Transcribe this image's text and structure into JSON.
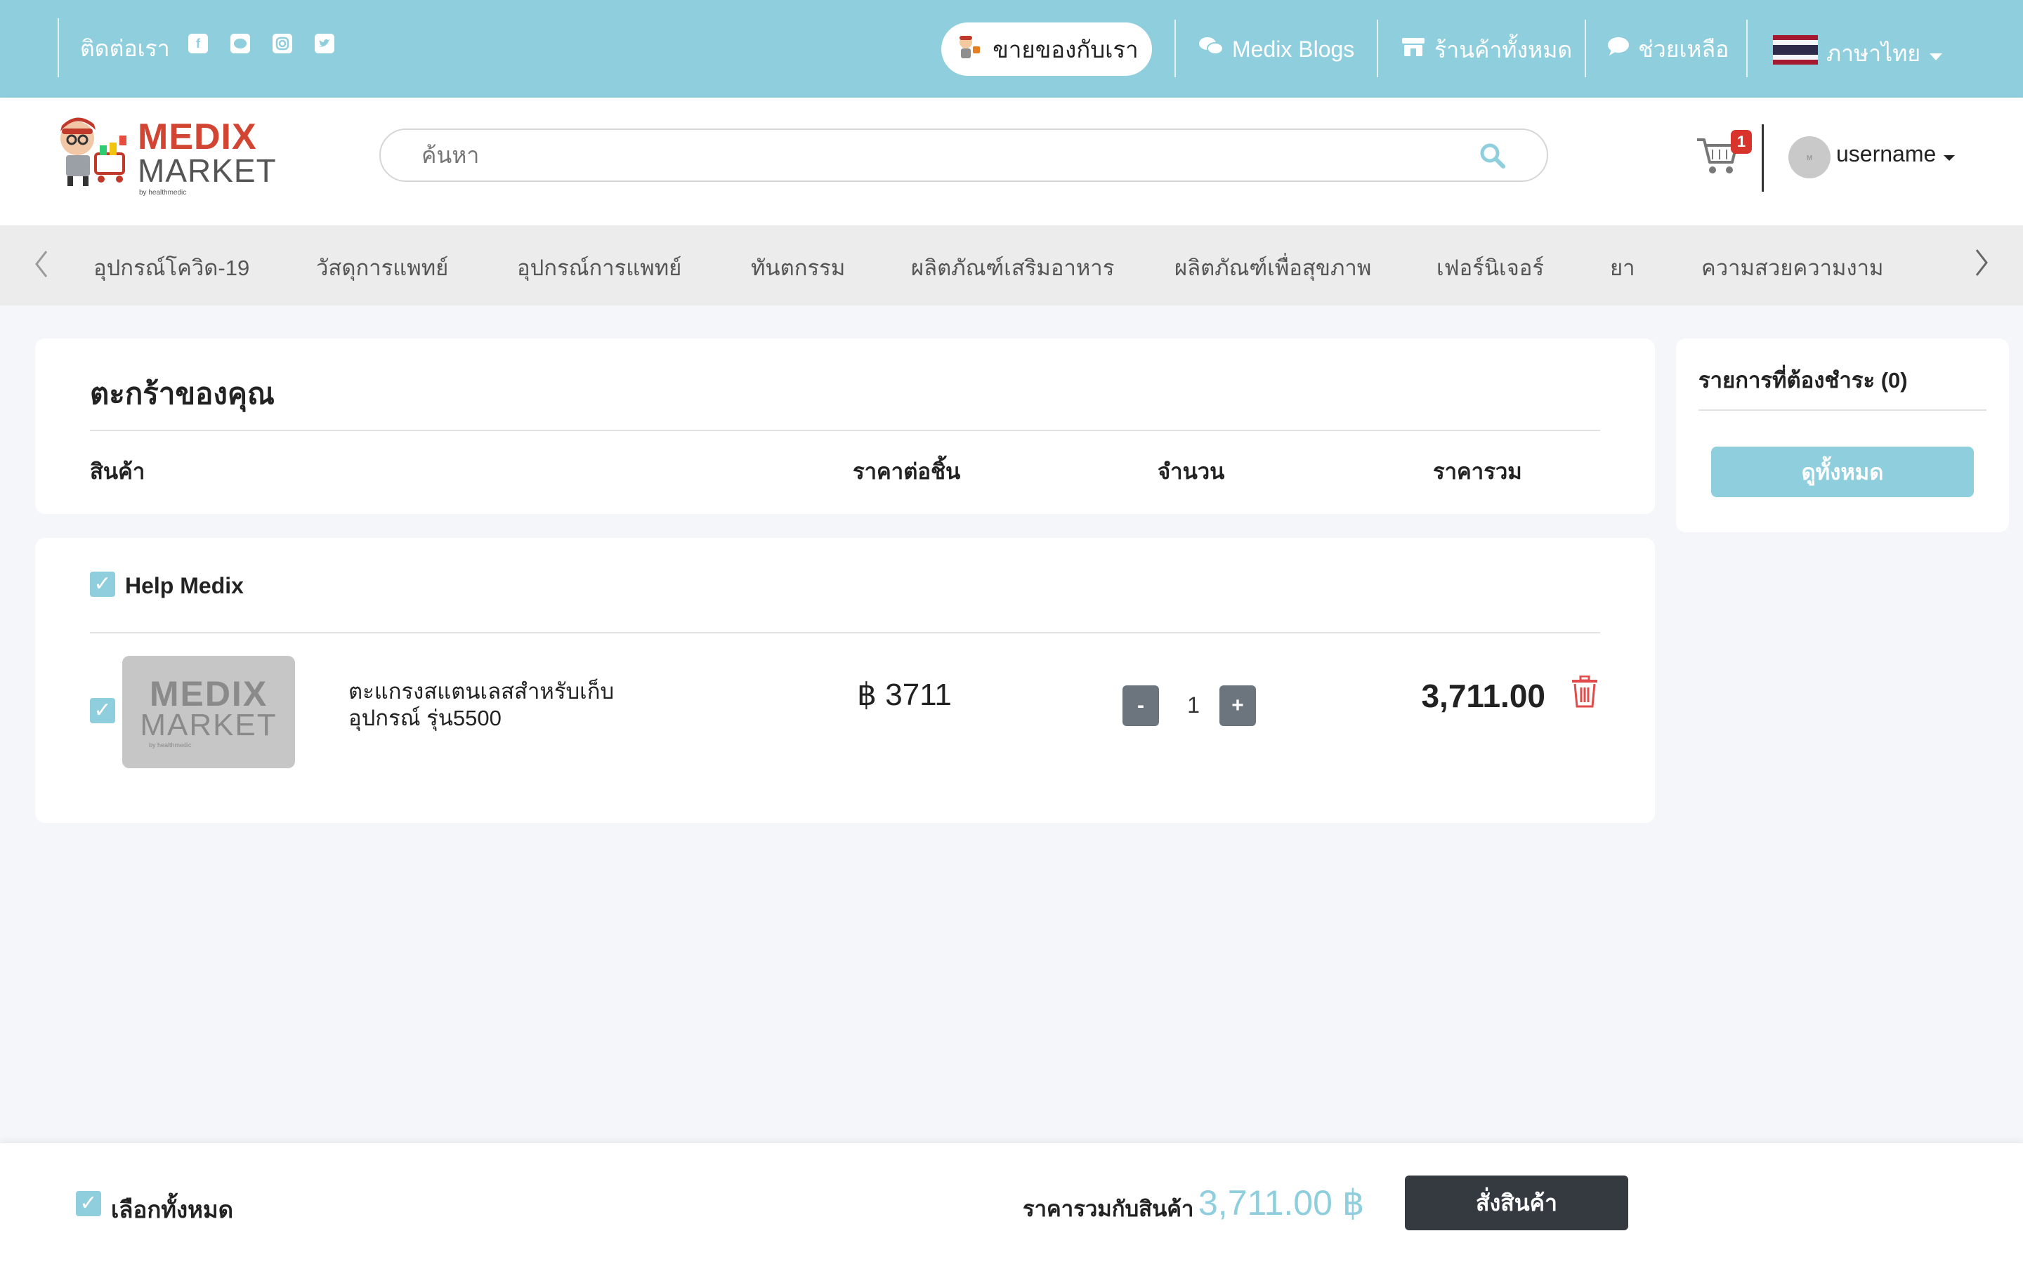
{
  "topbar": {
    "contact_label": "ติดต่อเรา",
    "social_icons": [
      "facebook-icon",
      "line-icon",
      "instagram-icon",
      "twitter-icon"
    ],
    "sell_label": "ขายของกับเรา",
    "blogs_label": "Medix Blogs",
    "stores_label": "ร้านค้าทั้งหมด",
    "help_label": "ช่วยเหลือ",
    "language_label": "ภาษาไทย"
  },
  "header": {
    "logo_top": "MEDIX",
    "logo_bottom": "MARKET",
    "logo_tagline": "by healthmedic",
    "search_placeholder": "ค้นหา",
    "cart_count": "1",
    "username": "username"
  },
  "categories": [
    "อุปกรณ์โควิด-19",
    "วัสดุการแพทย์",
    "อุปกรณ์การแพทย์",
    "ทันตกรรม",
    "ผลิตภัณฑ์เสริมอาหาร",
    "ผลิตภัณฑ์เพื่อสุขภาพ",
    "เฟอร์นิเจอร์",
    "ยา",
    "ความสวยความงาม"
  ],
  "cart": {
    "title": "ตะกร้าของคุณ",
    "columns": {
      "product": "สินค้า",
      "unit_price": "ราคาต่อชิ้น",
      "quantity": "จำนวน",
      "total": "ราคารวม"
    },
    "shop": {
      "name": "Help Medix",
      "item": {
        "thumb_top": "MEDIX",
        "thumb_bottom": "MARKET",
        "thumb_tagline": "by healthmedic",
        "name_line1": "ตะแกรงสแตนเลสสำหรับเก็บ",
        "name_line2": "อุปกรณ์ รุ่น5500",
        "unit_price": "฿ 3711",
        "qty": "1",
        "qty_minus": "-",
        "qty_plus": "+",
        "line_total": "3,711.00"
      }
    }
  },
  "summary": {
    "title": "รายการที่ต้องชำระ (0)",
    "view_all": "ดูทั้งหมด"
  },
  "footer": {
    "select_all": "เลือกทั้งหมด",
    "total_label": "ราคารวมกับสินค้า",
    "total_value": "3,711.00 ฿",
    "order_button": "สั่งสินค้า"
  },
  "colors": {
    "accent": "#8fcedd",
    "brand_red": "#d24532",
    "dark_button": "#343a40",
    "delete_red": "#e24b4b"
  }
}
